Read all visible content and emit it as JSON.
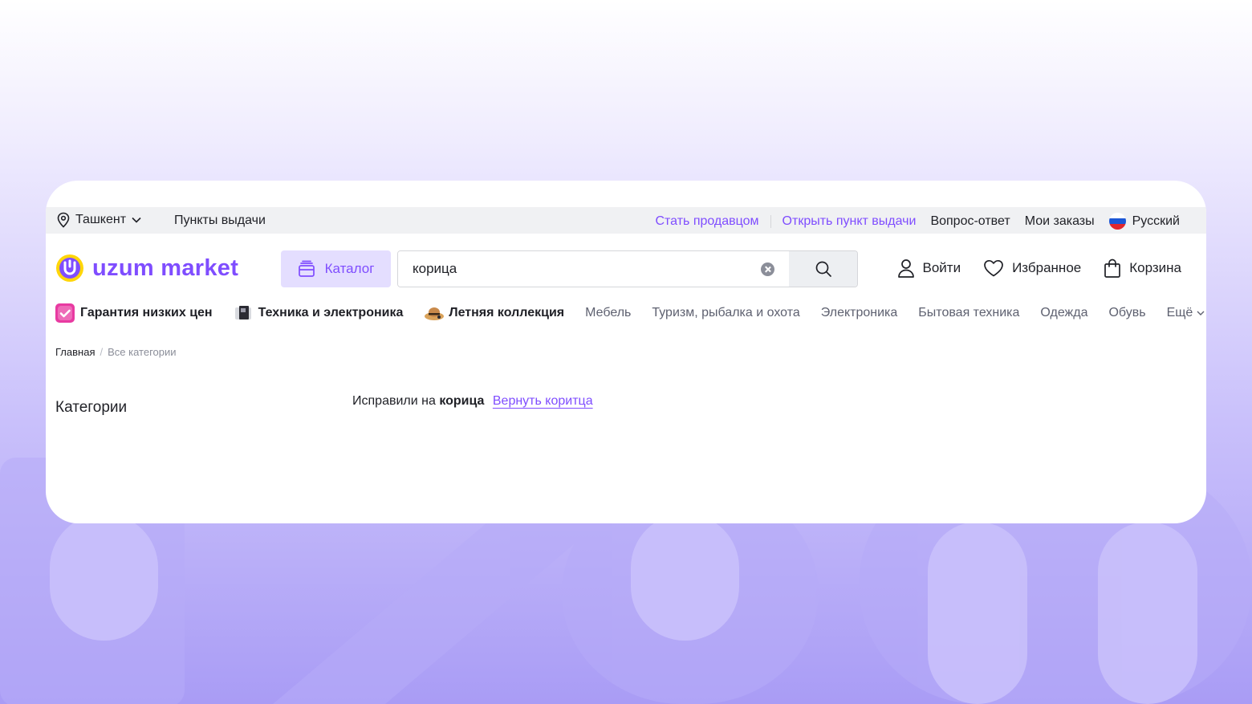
{
  "topbar": {
    "city": "Ташкент",
    "pickup_points": "Пункты выдачи",
    "become_seller": "Стать продавцом",
    "open_pickup": "Открыть пункт выдачи",
    "faq": "Вопрос-ответ",
    "my_orders": "Мои заказы",
    "language": "Русский"
  },
  "header": {
    "logo_text": "uzum market",
    "catalog_label": "Каталог",
    "search_value": "корица",
    "login": "Войти",
    "favorites": "Избранное",
    "cart": "Корзина"
  },
  "categories": [
    {
      "label": "Гарантия низких цен",
      "bold": true,
      "icon": "guarantee-check-icon",
      "color": "#e83aa1"
    },
    {
      "label": "Техника и электроника",
      "bold": true,
      "icon": "electronics-icon",
      "color": "#5a5a66"
    },
    {
      "label": "Летняя коллекция",
      "bold": true,
      "icon": "summer-hat-icon",
      "color": "#c98a4b"
    },
    {
      "label": "Мебель",
      "bold": false
    },
    {
      "label": "Туризм, рыбалка и охота",
      "bold": false
    },
    {
      "label": "Электроника",
      "bold": false
    },
    {
      "label": "Бытовая техника",
      "bold": false
    },
    {
      "label": "Одежда",
      "bold": false
    },
    {
      "label": "Обувь",
      "bold": false
    }
  ],
  "more_label": "Ещё",
  "breadcrumbs": {
    "home": "Главная",
    "current": "Все категории"
  },
  "sidebar_title": "Категории",
  "correction": {
    "prefix": "Исправили на",
    "corrected": "корица",
    "revert": "Вернуть коритца"
  },
  "colors": {
    "accent": "#7f4dff",
    "accent_light": "#e4deff",
    "logo_yellow": "#ffd60a"
  }
}
